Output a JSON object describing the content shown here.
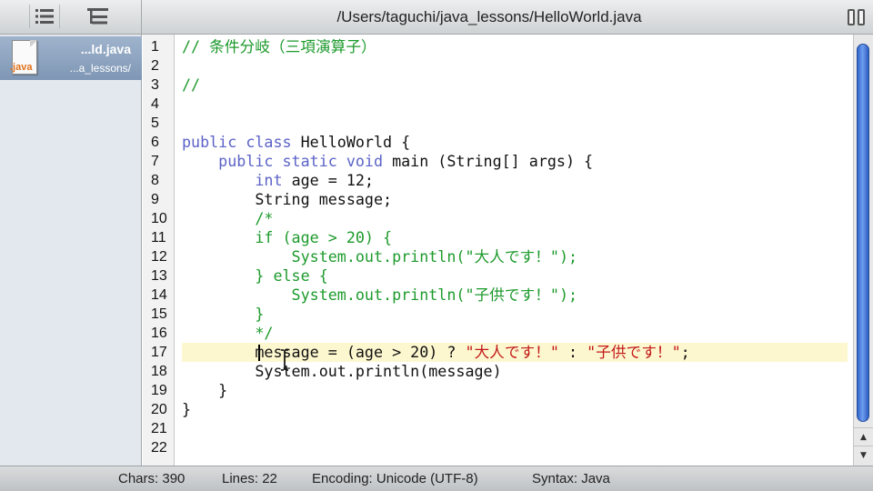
{
  "window": {
    "file_path": "/Users/taguchi/java_lessons/HelloWorld.java"
  },
  "toolbar": {
    "list_icon": "list-icon",
    "tree_icon": "tree-icon",
    "split_icon": "split-view-icon"
  },
  "sidebar": {
    "document": {
      "extension": ".java",
      "name": "...ld.java",
      "folder": "...a_lessons/"
    }
  },
  "editor": {
    "line_numbers": [
      "1",
      "2",
      "3",
      "4",
      "5",
      "6",
      "7",
      "8",
      "9",
      "10",
      "11",
      "12",
      "13",
      "14",
      "15",
      "16",
      "17",
      "18",
      "19",
      "20",
      "21",
      "22"
    ],
    "current_line": 17,
    "lines": [
      [
        {
          "t": "// 条件分岐（三項演算子）",
          "c": "comment"
        }
      ],
      [],
      [
        {
          "t": "//",
          "c": "comment"
        }
      ],
      [],
      [],
      [
        {
          "t": "public class ",
          "c": "kw"
        },
        {
          "t": "HelloWorld {",
          "c": "txt"
        }
      ],
      [
        {
          "t": "    public static void ",
          "c": "kw"
        },
        {
          "t": "main (String[] args) {",
          "c": "txt"
        }
      ],
      [
        {
          "t": "        int ",
          "c": "kw"
        },
        {
          "t": "age = 12;",
          "c": "txt"
        }
      ],
      [
        {
          "t": "        String message;",
          "c": "txt"
        }
      ],
      [
        {
          "t": "        /*",
          "c": "comment"
        }
      ],
      [
        {
          "t": "        if (age > 20) {",
          "c": "comment"
        }
      ],
      [
        {
          "t": "            System.out.println(\"大人です！\");",
          "c": "comment"
        }
      ],
      [
        {
          "t": "        } else {",
          "c": "comment"
        }
      ],
      [
        {
          "t": "            System.out.println(\"子供です！\");",
          "c": "comment"
        }
      ],
      [
        {
          "t": "        }",
          "c": "comment"
        }
      ],
      [
        {
          "t": "        */",
          "c": "comment"
        }
      ],
      [
        {
          "t": "        message = (age > 20) ? ",
          "c": "txt"
        },
        {
          "t": "\"大人です！\"",
          "c": "str"
        },
        {
          "t": " : ",
          "c": "txt"
        },
        {
          "t": "\"子供です！\"",
          "c": "str"
        },
        {
          "t": ";",
          "c": "txt"
        }
      ],
      [
        {
          "t": "        System.out.println(message)",
          "c": "txt"
        }
      ],
      [
        {
          "t": "    }",
          "c": "txt"
        }
      ],
      [
        {
          "t": "}",
          "c": "txt"
        }
      ],
      [],
      []
    ]
  },
  "status": {
    "chars": "Chars: 390",
    "lines": "Lines: 22",
    "encoding": "Encoding: Unicode (UTF-8)",
    "syntax": "Syntax: Java"
  },
  "colors": {
    "comment": "#1d9a2c",
    "keyword": "#5b63c7",
    "string": "#c21a1a",
    "current_line": "#fdf7cf",
    "selection": "#8aa3c2"
  }
}
